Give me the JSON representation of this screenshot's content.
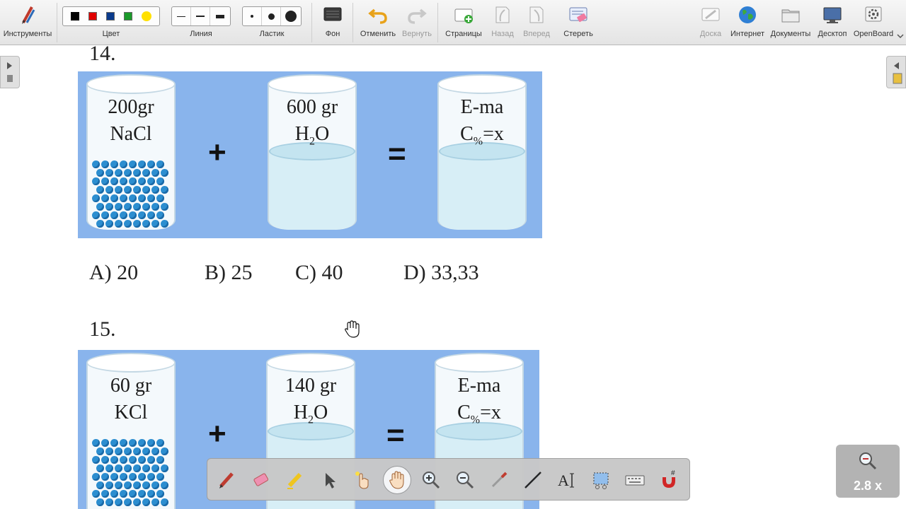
{
  "toolbar": {
    "tools_label": "Инструменты",
    "color_label": "Цвет",
    "colors": [
      "#000000",
      "#e00000",
      "#0a3a8c",
      "#1a9a2a",
      "#ffe000"
    ],
    "line_label": "Линия",
    "eraser_label": "Ластик",
    "background_label": "Фон",
    "undo_label": "Отменить",
    "redo_label": "Вернуть",
    "pages_label": "Страницы",
    "back_label": "Назад",
    "forward_label": "Вперед",
    "erase_label": "Стереть",
    "board_label": "Доска",
    "internet_label": "Интернет",
    "documents_label": "Документы",
    "desktop_label": "Десктоп",
    "openboard_label": "OpenBoard"
  },
  "questions": [
    {
      "number": "14.",
      "beaker1": {
        "line1": "200gr",
        "line2": "NaCl"
      },
      "beaker2": {
        "line1": "600 gr",
        "line2_main": "H",
        "line2_sub": "2",
        "line2_rest": "O"
      },
      "beaker3": {
        "line1": "E-ma",
        "line2_main": "C",
        "line2_sub": "%",
        "line2_rest": "=x"
      },
      "plus": "+",
      "equals": "=",
      "answers": {
        "a": "A) 20",
        "b": "B) 25",
        "c": "C) 40",
        "d": "D) 33,33"
      }
    },
    {
      "number": "15.",
      "beaker1": {
        "line1": "60 gr",
        "line2": "KCl"
      },
      "beaker2": {
        "line1": "140 gr",
        "line2_main": "H",
        "line2_sub": "2",
        "line2_rest": "O"
      },
      "beaker3": {
        "line1": "E-ma",
        "line2_main": "C",
        "line2_sub": "%",
        "line2_rest": "=x"
      },
      "plus": "+",
      "equals": "="
    }
  ],
  "zoom": {
    "value": "2.8 x"
  },
  "icons": {
    "floatbar": [
      "pen-icon",
      "eraser-icon",
      "highlighter-icon",
      "pointer-icon",
      "laser-pointer-icon",
      "hand-icon",
      "zoom-in-icon",
      "zoom-out-icon",
      "pipette-icon",
      "line-icon",
      "text-icon",
      "capture-icon",
      "keyboard-icon",
      "magnet-icon"
    ]
  }
}
